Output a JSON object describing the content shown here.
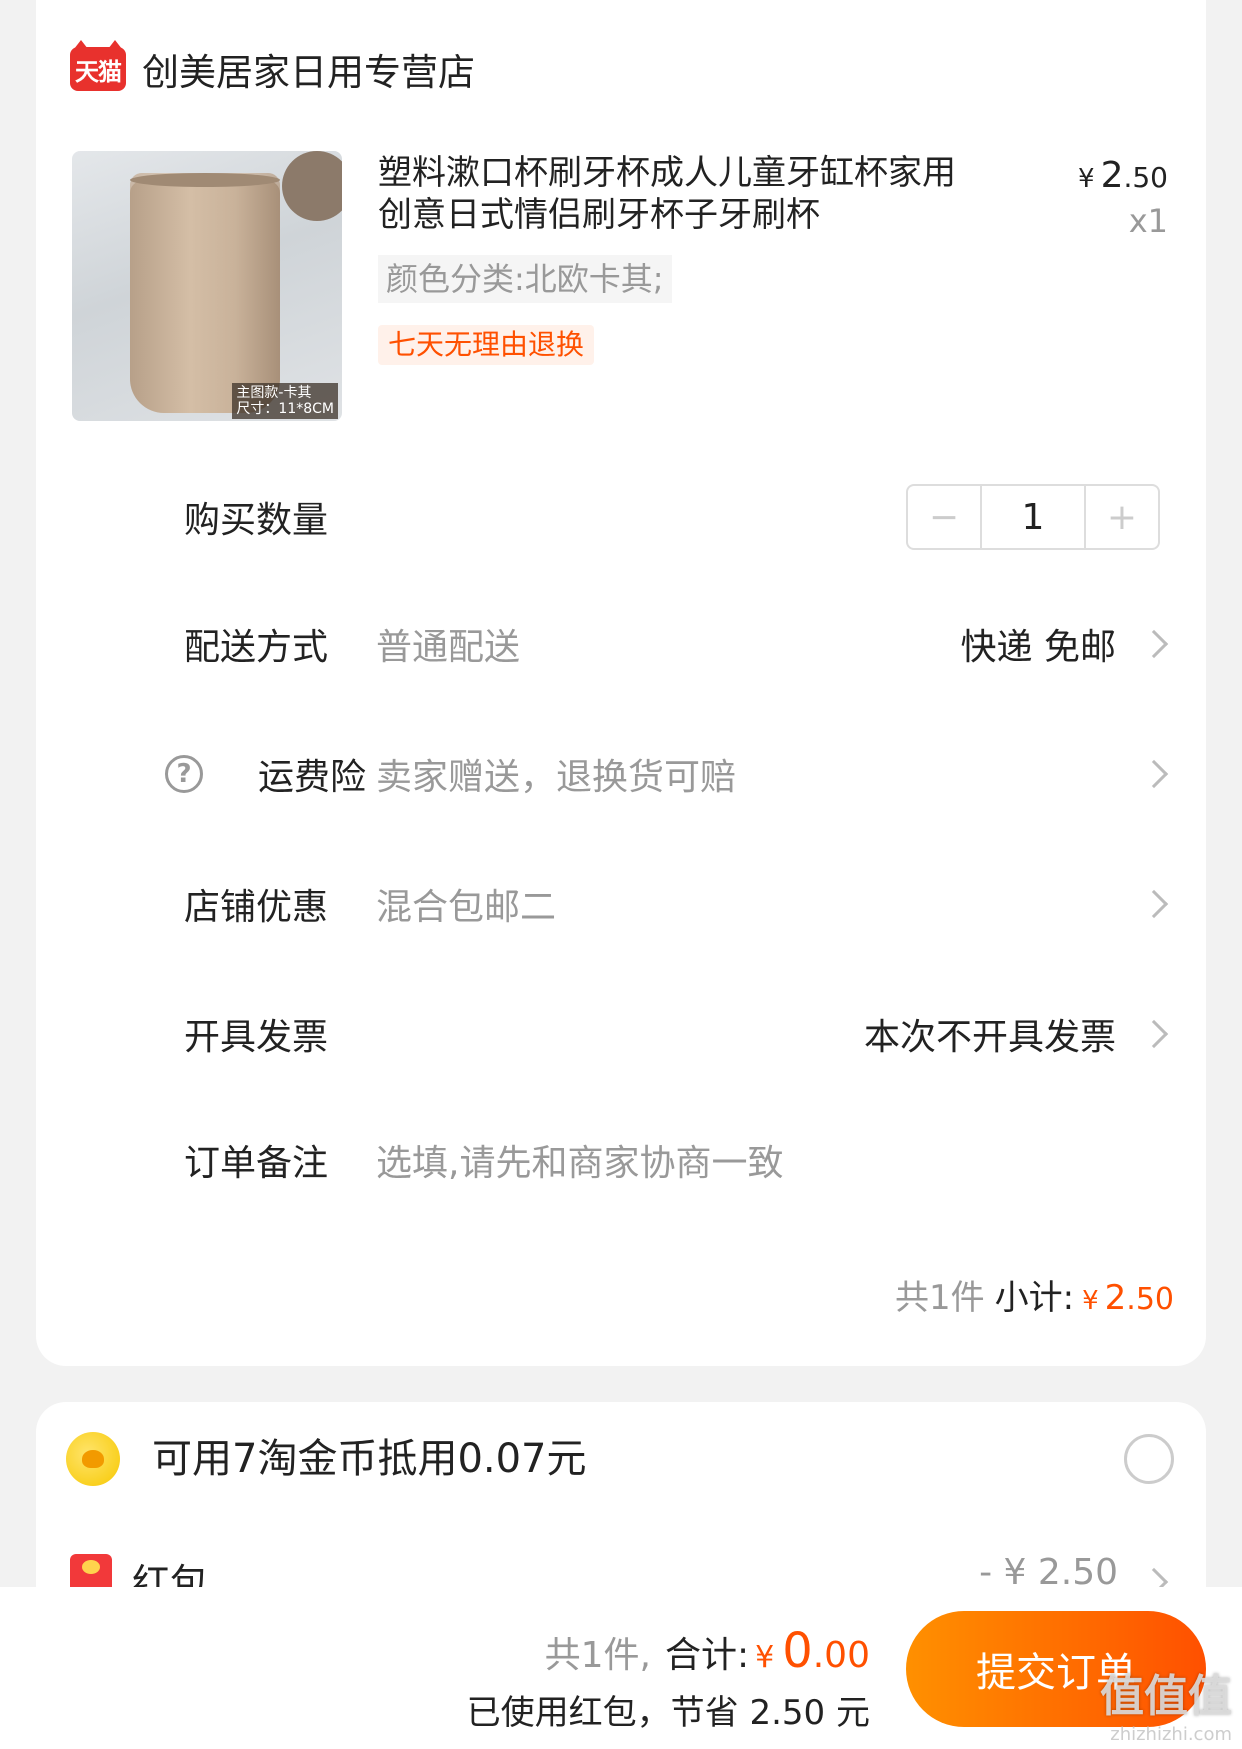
{
  "store": {
    "badge": "天猫",
    "name": "创美居家日用专营店"
  },
  "product": {
    "image_caption_line1": "主图款-卡其",
    "image_caption_line2": "尺寸：11*8CM",
    "title": "塑料漱口杯刷牙杯成人儿童牙缸杯家用创意日式情侣刷牙杯子牙刷杯",
    "sku": "颜色分类:北欧卡其;",
    "tag": "七天无理由退换",
    "price_symbol": "¥",
    "price_int": "2",
    "price_dec": ".50",
    "quantity": "x1"
  },
  "quantity_row": {
    "label": "购买数量",
    "minus": "−",
    "value": "1",
    "plus": "+"
  },
  "delivery_row": {
    "label": "配送方式",
    "value": "普通配送",
    "right": "快递 免邮"
  },
  "insurance_row": {
    "help": "?",
    "label": "运费险",
    "value": "卖家赠送，退换货可赔"
  },
  "promo_row": {
    "label": "店铺优惠",
    "value": "混合包邮二"
  },
  "invoice_row": {
    "label": "开具发票",
    "right": "本次不开具发票"
  },
  "remark_row": {
    "label": "订单备注",
    "placeholder": "选填,请先和商家协商一致"
  },
  "subtotal": {
    "count": "共1件",
    "label": "小计:",
    "symbol": "¥",
    "int": "2",
    "dec": ".50"
  },
  "coin": {
    "text": "可用7淘金币抵用0.07元"
  },
  "hongbao": {
    "label": "红包",
    "value": "- ¥ 2.50"
  },
  "bottom": {
    "count": "共1件,",
    "label": "合计:",
    "symbol": "¥",
    "int": "0",
    "dec": ".00",
    "saving": "已使用红包，节省 2.50 元",
    "submit": "提交订单"
  },
  "watermark": {
    "logo": "值值值",
    "url": "zhizhizhi.com"
  },
  "colors": {
    "accent": "#ff5000",
    "tmall": "#e8312d",
    "button_start": "#ff9000",
    "button_end": "#ff5000"
  }
}
